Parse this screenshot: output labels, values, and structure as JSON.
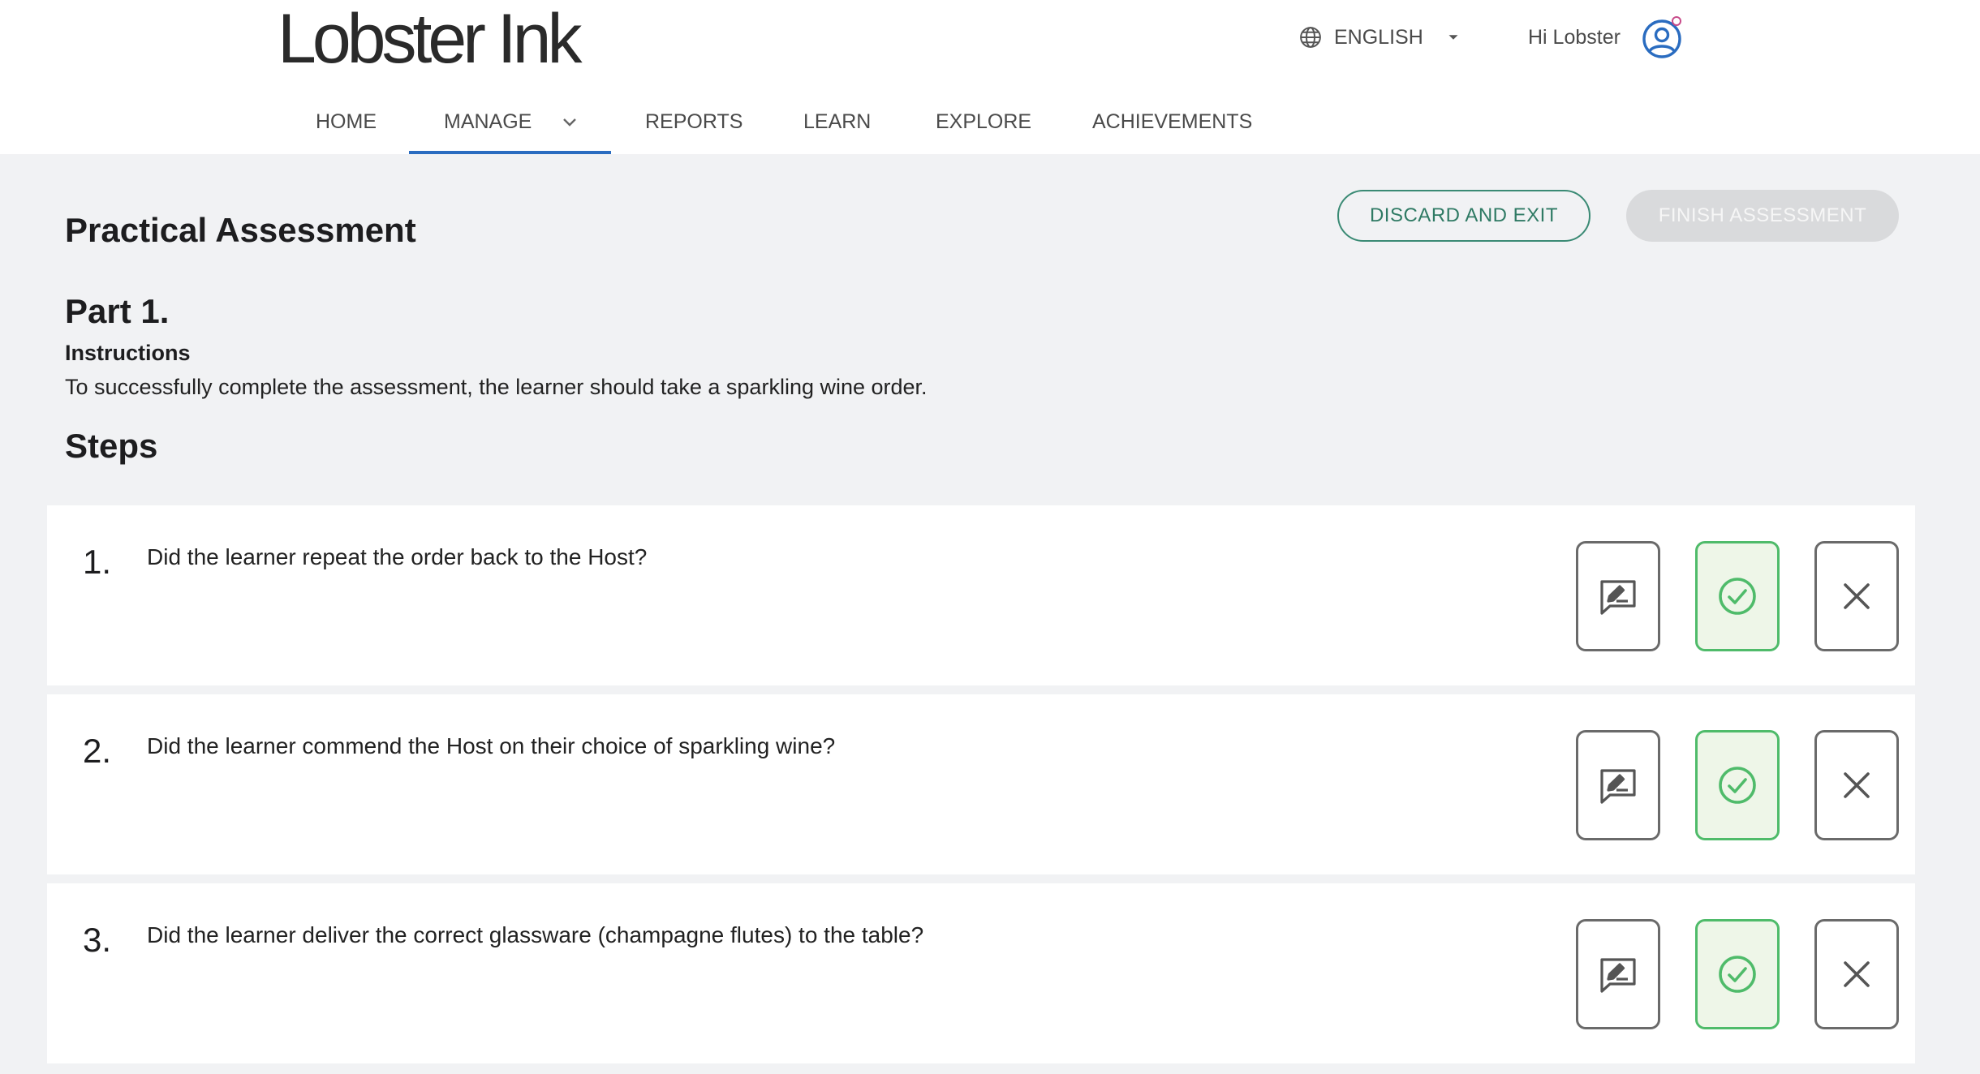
{
  "header": {
    "logo": "Lobster Ink",
    "language": "ENGLISH",
    "greeting": "Hi Lobster"
  },
  "nav": {
    "items": [
      {
        "label": "HOME",
        "active": false
      },
      {
        "label": "MANAGE",
        "active": true,
        "has_dropdown": true
      },
      {
        "label": "REPORTS",
        "active": false
      },
      {
        "label": "LEARN",
        "active": false
      },
      {
        "label": "EXPLORE",
        "active": false
      },
      {
        "label": "ACHIEVEMENTS",
        "active": false
      }
    ]
  },
  "page": {
    "title": "Practical Assessment",
    "discard_label": "DISCARD AND EXIT",
    "finish_label": "FINISH ASSESSMENT",
    "part_title": "Part 1.",
    "instructions_label": "Instructions",
    "instructions_text": "To successfully complete the assessment, the learner should take a sparkling wine order.",
    "steps_title": "Steps"
  },
  "steps": [
    {
      "number": "1.",
      "question": "Did the learner repeat the order back to the Host?",
      "status": "pass"
    },
    {
      "number": "2.",
      "question": "Did the learner commend the Host on their choice of sparkling wine?",
      "status": "pass"
    },
    {
      "number": "3.",
      "question": "Did the learner deliver the correct glassware (champagne flutes) to the table?",
      "status": "pass"
    }
  ],
  "colors": {
    "accent_blue": "#2a6cc0",
    "discard_green": "#2f7a64",
    "pass_green": "#4fbb6a",
    "pass_bg": "#eef6e8",
    "page_bg": "#f1f2f4"
  },
  "icons": {
    "language": "globe-icon",
    "language_caret": "caret-down-icon",
    "avatar": "user-circle-icon",
    "manage_dropdown": "chevron-down-icon",
    "comment": "comment-edit-icon",
    "pass": "check-circle-icon",
    "fail": "close-icon"
  }
}
